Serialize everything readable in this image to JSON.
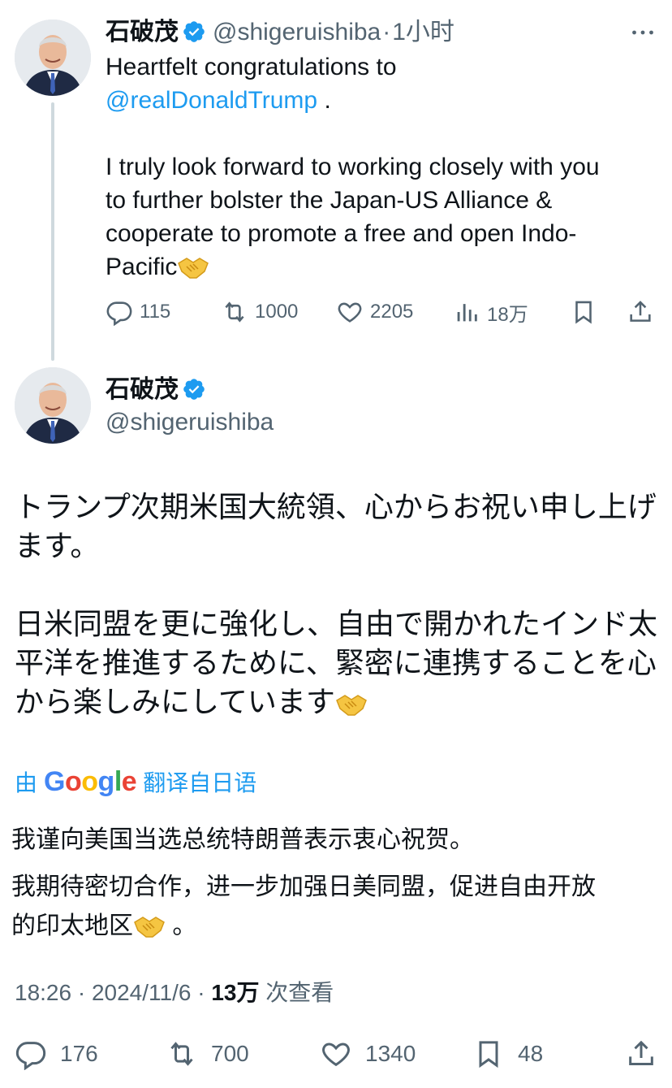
{
  "tweet1": {
    "author_name": "石破茂",
    "handle": "@shigeruishiba",
    "time": "1小时",
    "lines": [
      "Heartfelt congratulations to",
      "@realDonaldTrump",
      " .",
      "I truly look forward to working closely with you",
      "to further bolster the Japan-US Alliance &",
      "cooperate to promote a free and open Indo-",
      "Pacific"
    ],
    "emoji": "handshake-emoji",
    "stats": {
      "replies": "115",
      "reposts": "1000",
      "likes": "2205",
      "views": "18万"
    }
  },
  "tweet2": {
    "author_name": "石破茂",
    "handle": "@shigeruishiba",
    "body": [
      "トランプ次期米国大統領、心からお祝い申し上げ",
      "ます。",
      "日米同盟を更に強化し、自由で開かれたインド太",
      "平洋を推進するために、緊密に連携することを心",
      "から楽しみにしています"
    ],
    "translation_prefix": "由",
    "translation_brand": "Google",
    "translation_suffix": "翻译自日语",
    "translated": [
      "我谨向美国当选总统特朗普表示衷心祝贺。",
      "我期待密切合作，进一步加强日美同盟，促进自由开放",
      "的印太地区",
      " 。"
    ],
    "meta": {
      "time": "18:26",
      "date": "2024/11/6",
      "views": "13万",
      "views_label": "次查看"
    },
    "stats": {
      "replies": "176",
      "reposts": "700",
      "likes": "1340",
      "bookmarks": "48"
    }
  },
  "colors": {
    "text": "#0f1419",
    "secondary": "#536471",
    "link": "#1d9bf0",
    "verified": "#1d9bf0",
    "thread_line": "#cfd9de"
  }
}
